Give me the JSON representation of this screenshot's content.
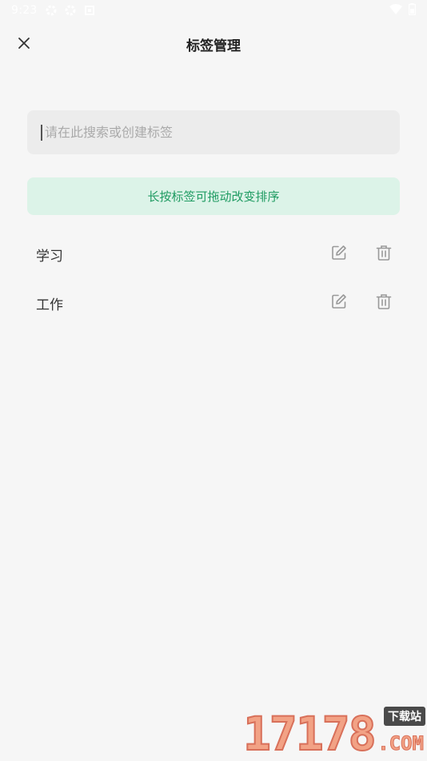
{
  "status_bar": {
    "time": "9:23",
    "left_icons": [
      "settings-gear-icon",
      "settings-gear-icon",
      "notification-square-icon"
    ],
    "right_icons": [
      "wifi-icon",
      "battery-icon"
    ]
  },
  "header": {
    "title": "标签管理",
    "close_icon": "close-icon"
  },
  "search": {
    "placeholder": "请在此搜索或创建标签",
    "value": ""
  },
  "hint": {
    "text": "长按标签可拖动改变排序"
  },
  "tags": [
    {
      "label": "学习"
    },
    {
      "label": "工作"
    }
  ],
  "watermark": {
    "digits": "17178",
    "badge": "下载站",
    "suffix": ".COM"
  },
  "colors": {
    "background": "#f6f6f6",
    "hint_bg": "#dcf3e8",
    "hint_text": "#1f9b62",
    "search_bg": "#ececec",
    "icon_gray": "#999999"
  }
}
